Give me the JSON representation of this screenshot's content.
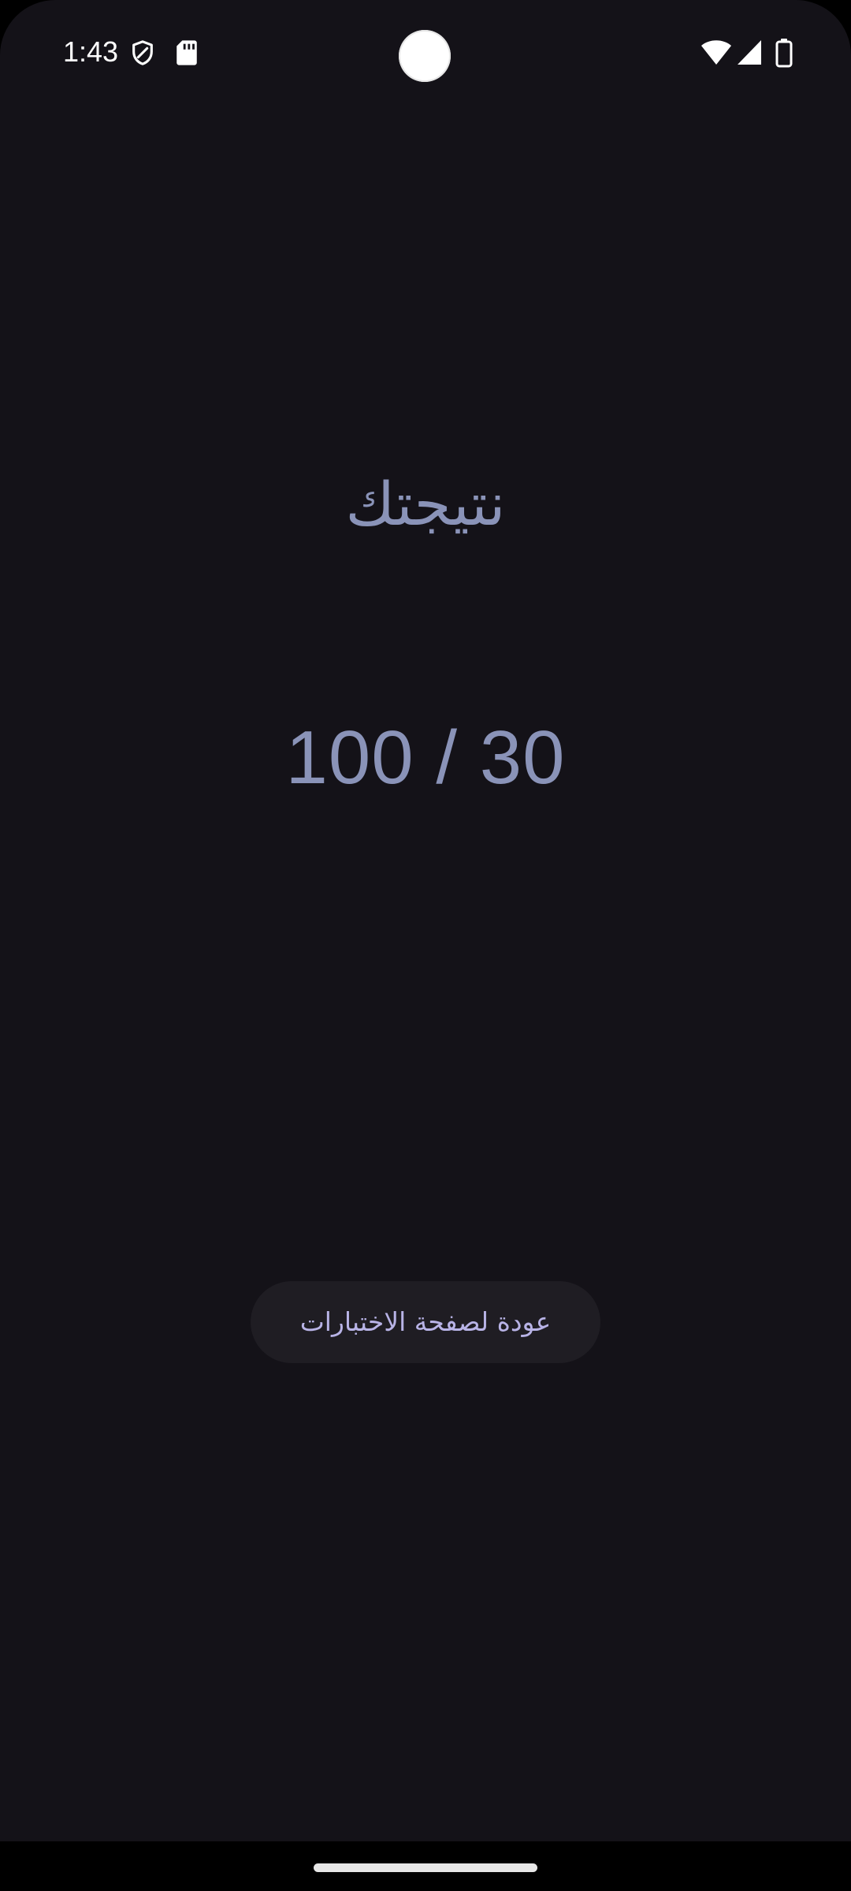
{
  "status_bar": {
    "time": "1:43",
    "left_icons": [
      "shield-icon",
      "sd-card-icon"
    ],
    "right_icons": [
      "wifi-icon",
      "cellular-signal-icon",
      "battery-icon"
    ]
  },
  "result": {
    "title": "نتيجتك",
    "score": "100 / 30"
  },
  "actions": {
    "back_label": "عودة لصفحة الاختبارات"
  },
  "colors": {
    "background": "#141218",
    "primary_text": "#8a93b8",
    "button_background": "#1f1d23",
    "button_text": "#b8b3e6"
  }
}
